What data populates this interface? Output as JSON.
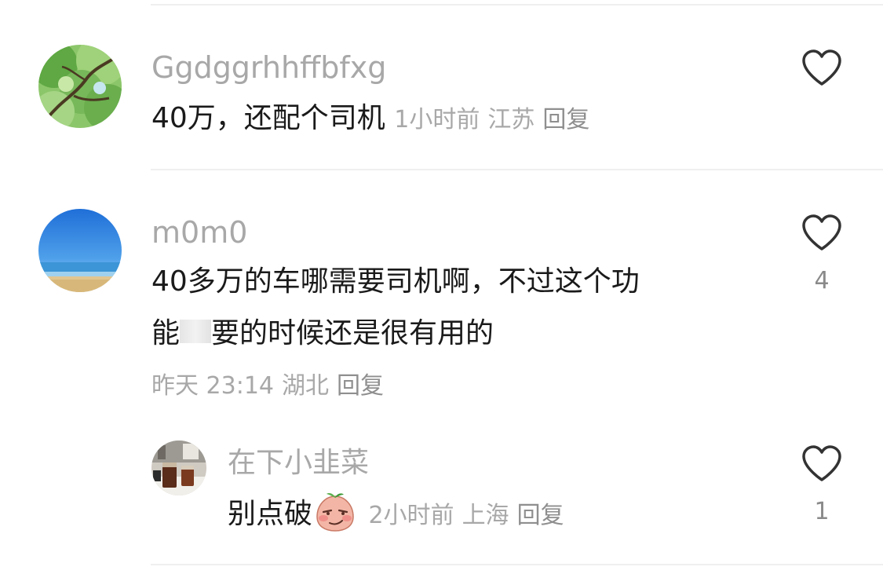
{
  "comments": [
    {
      "username": "Ggdggrhhffbfxg",
      "text": "40万，还配个司机",
      "time": "1小时前",
      "location": "江苏",
      "reply_label": "回复",
      "avatar_icon": "tree-canopy-avatar",
      "like_count": ""
    },
    {
      "username": "m0m0",
      "text_line1": "40多万的车哪需要司机啊，不过这个功",
      "text_line2_a": "能",
      "text_line2_b": "要的时候还是很有用的",
      "time": "昨天 23:14",
      "location": "湖北",
      "reply_label": "回复",
      "avatar_icon": "ocean-beach-avatar",
      "like_count": "4",
      "replies": [
        {
          "username": "在下小韭菜",
          "text": "别点破",
          "emoji_icon": "smirk-peach-emoji",
          "time": "2小时前",
          "location": "上海",
          "reply_label": "回复",
          "avatar_icon": "cafe-drinks-avatar",
          "like_count": "1"
        }
      ]
    }
  ],
  "colors": {
    "username": "#a8a8a8",
    "text": "#1a1a1a",
    "meta": "#a8a8a8",
    "divider": "#efefef"
  }
}
